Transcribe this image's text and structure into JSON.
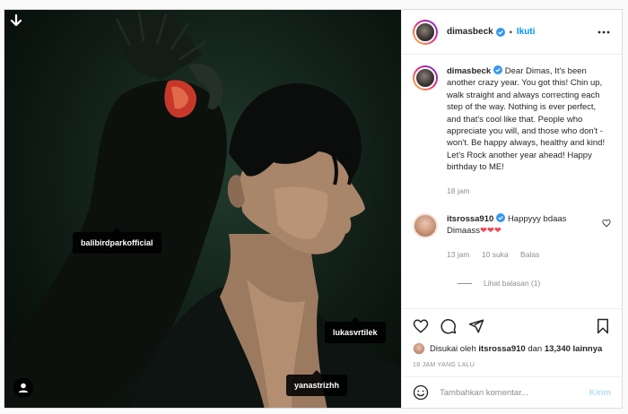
{
  "colors": {
    "link": "#0095f6",
    "text": "#262626",
    "muted": "#8e8e8e",
    "post_disabled": "#b2dffc",
    "verified": "#3897f0",
    "heart": "#ed4956"
  },
  "header": {
    "username": "dimasbeck",
    "separator": "•",
    "follow_label": "Ikuti"
  },
  "photo": {
    "tags": [
      "balibirdparkofficial",
      "lukasvrtilek",
      "yanastrizhh"
    ]
  },
  "caption": {
    "username": "dimasbeck",
    "text": "Dear Dimas, It's been another crazy year. You got this! Chin up, walk straight and always correcting each step of the way. Nothing is ever perfect, and that's cool like that. People who appreciate you will, and those who don't - won't. Be happy always, healthy and kind! Let's Rock another year ahead! Happy birthday to ME!",
    "time": "18 jam"
  },
  "comment": {
    "username": "itsrossa910",
    "text": "Happyyy bdaas Dimaass",
    "emoji": "❤❤❤",
    "time": "13 jam",
    "likes": "10 suka",
    "reply_label": "Balas",
    "view_replies": "Lihat balasan (1)"
  },
  "likes": {
    "prefix": "Disukai oleh",
    "user": "itsrossa910",
    "joiner": "dan",
    "count": "13,340 lainnya"
  },
  "timestamp": "18 JAM YANG LALU",
  "add_comment": {
    "placeholder": "Tambahkan komentar...",
    "post_label": "Kirim"
  },
  "icons": [
    "download-arrow-icon",
    "user-tag-icon",
    "verified-badge-icon",
    "more-options-icon",
    "heart-icon",
    "comment-icon",
    "share-icon",
    "bookmark-icon",
    "emoji-icon"
  ]
}
